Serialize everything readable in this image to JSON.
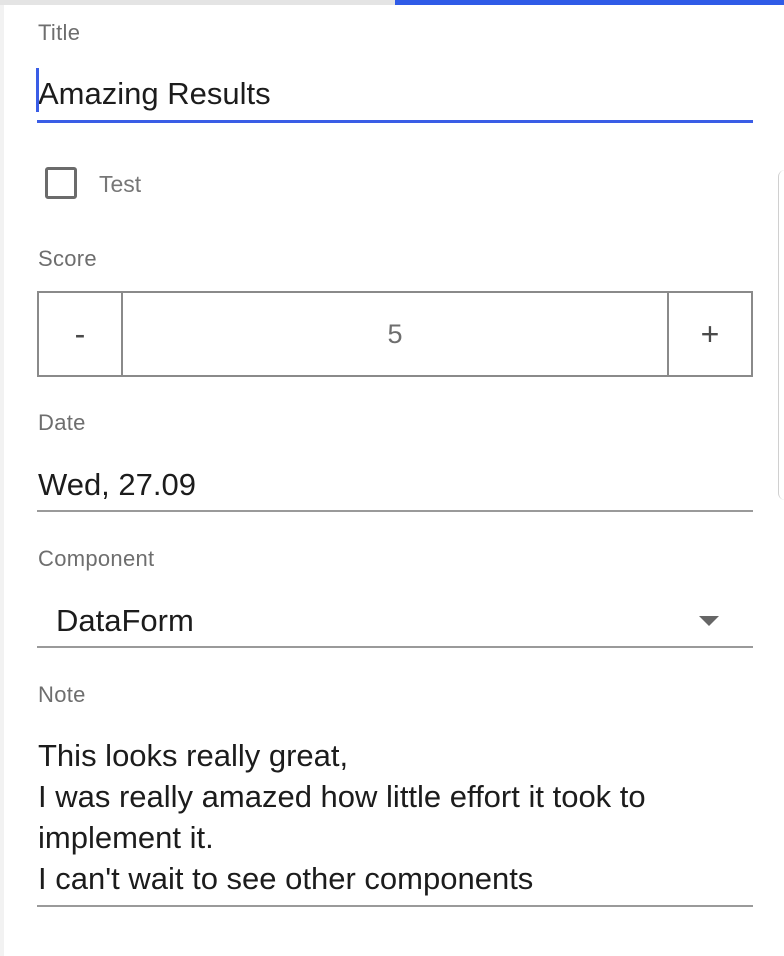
{
  "form": {
    "title": {
      "label": "Title",
      "value": "Amazing Results"
    },
    "test": {
      "label": "Test",
      "checked": false
    },
    "score": {
      "label": "Score",
      "value": "5",
      "decrement_label": "-",
      "increment_label": "+"
    },
    "date": {
      "label": "Date",
      "value": "Wed, 27.09"
    },
    "component": {
      "label": "Component",
      "selected": "DataForm"
    },
    "note": {
      "label": "Note",
      "value": "This looks really great,\nI was really amazed how little effort it took to implement it.\nI can't wait to see other components"
    }
  },
  "colors": {
    "accent": "#3a5de6",
    "tab_indicator": "#2f5be7",
    "label": "#6e6e6e",
    "text": "#1c1c1c",
    "underline": "#9a9a9a"
  },
  "icons": {
    "dropdown": "dropdown-arrow-icon",
    "checkbox": "checkbox-unchecked-icon"
  }
}
